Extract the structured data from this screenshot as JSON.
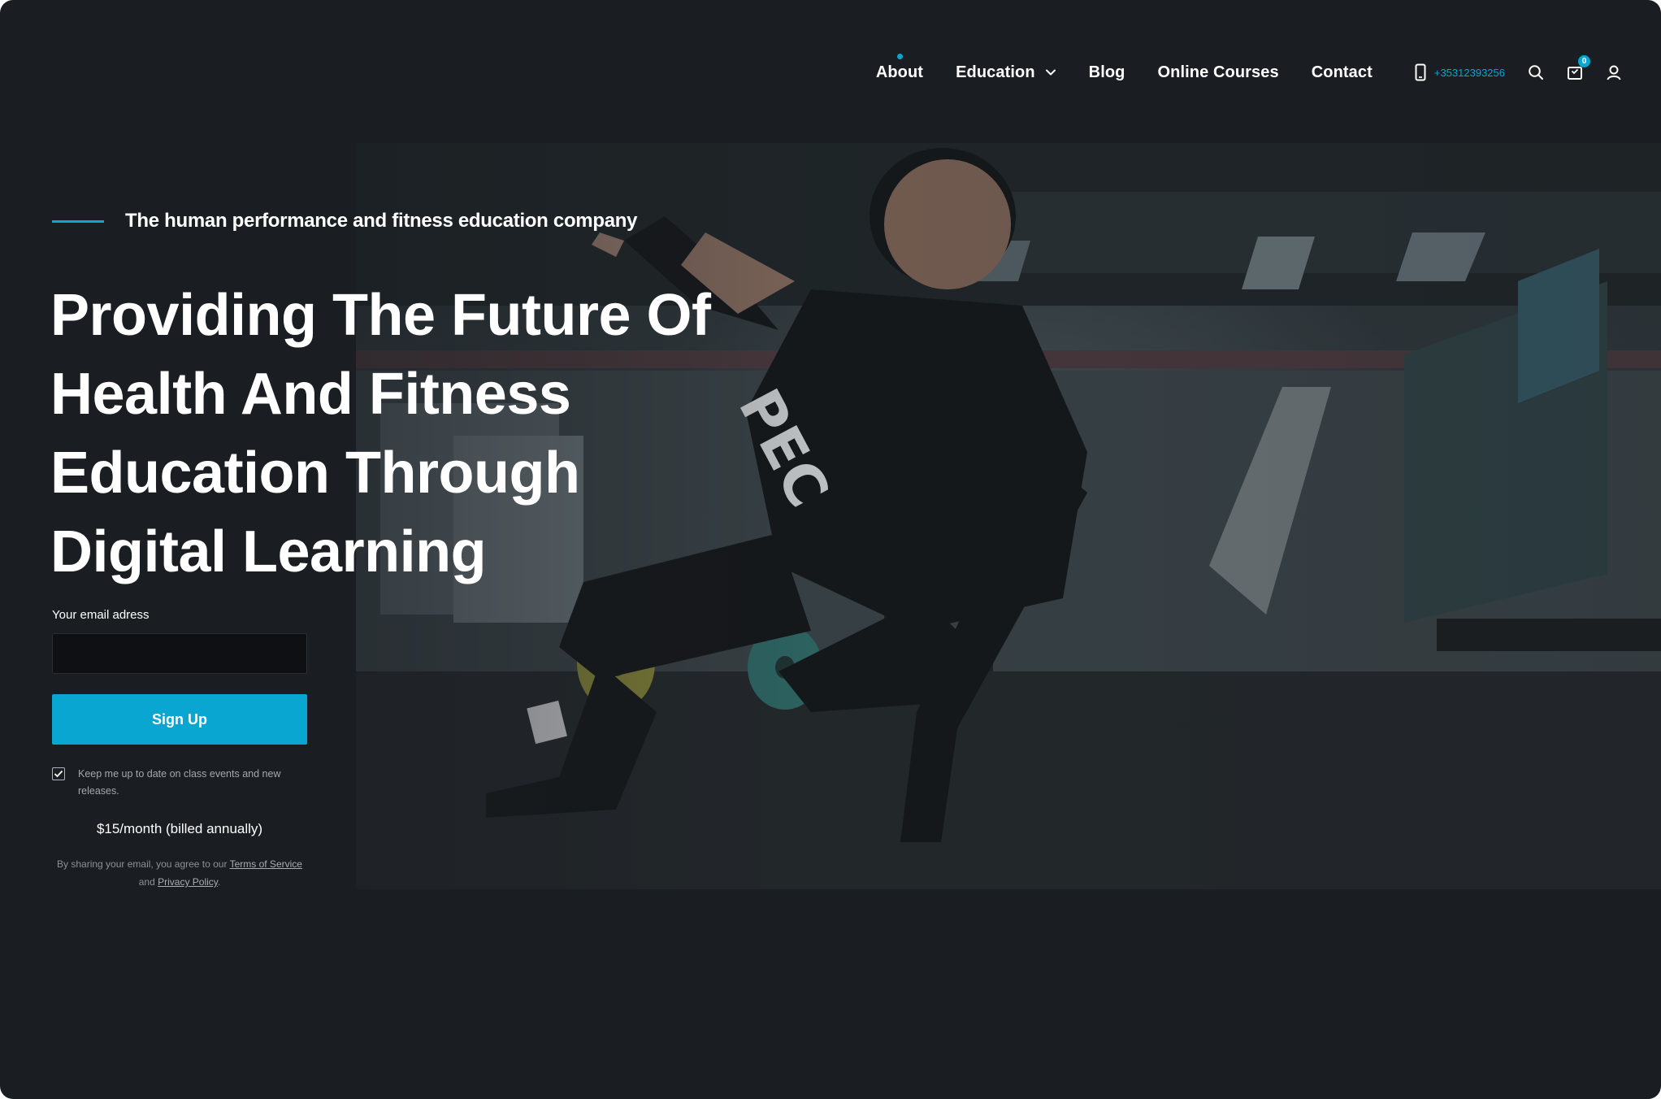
{
  "nav": {
    "items": [
      {
        "label": "About",
        "active": true
      },
      {
        "label": "Education",
        "has_dropdown": true
      },
      {
        "label": "Blog"
      },
      {
        "label": "Online Courses"
      },
      {
        "label": "Contact"
      }
    ],
    "phone": "+35312393256",
    "cart_count": "0",
    "icons": [
      "phone-icon",
      "search-icon",
      "cart-icon",
      "user-icon"
    ]
  },
  "hero": {
    "kicker": "The human performance and fitness education company",
    "headline_lines": [
      "Providing The Future Of",
      "Health And Fitness",
      "Education Through",
      "Digital Learning"
    ]
  },
  "form": {
    "email_label": "Your email adress",
    "email_value": "",
    "signup_label": "Sign Up",
    "optin_checked": true,
    "optin_text": "Keep me up to date on class events and new releases.",
    "price": "$15/month (billed annually)",
    "legal_prefix": "By sharing your email, you agree to our ",
    "terms_link": "Terms of Service",
    "legal_and": " and ",
    "privacy_link": "Privacy Policy",
    "legal_suffix": "."
  },
  "colors": {
    "background": "#1a1d22",
    "accent": "#0aa6d2",
    "text": "#ffffff"
  }
}
